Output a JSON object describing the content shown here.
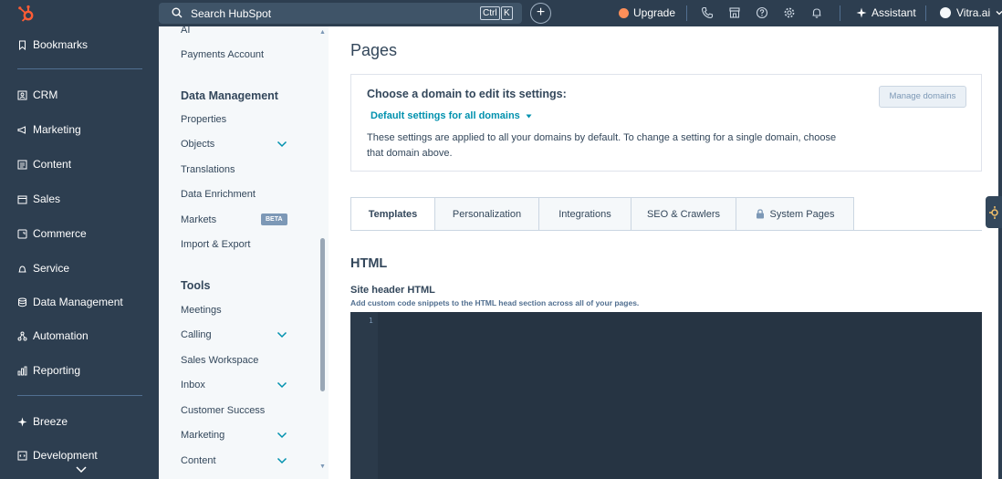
{
  "topbar": {
    "search_placeholder": "Search HubSpot",
    "kbd_ctrl": "Ctrl",
    "kbd_k": "K",
    "plus_label": "+",
    "upgrade_label": "Upgrade",
    "assistant_label": "Assistant",
    "account_name": "Vitra.ai"
  },
  "leftnav": {
    "bookmarks": "Bookmarks",
    "items": [
      "CRM",
      "Marketing",
      "Content",
      "Sales",
      "Commerce",
      "Service",
      "Data Management",
      "Automation",
      "Reporting"
    ],
    "breeze": "Breeze",
    "development": "Development"
  },
  "settingsnav": {
    "ai": "AI",
    "payments_account": "Payments Account",
    "data_management_heading": "Data Management",
    "data_management_items": [
      "Properties",
      "Objects",
      "Translations",
      "Data Enrichment",
      "Markets",
      "Import & Export"
    ],
    "beta_badge": "BETA",
    "tools_heading": "Tools",
    "tools_items": [
      "Meetings",
      "Calling",
      "Sales Workspace",
      "Inbox",
      "Customer Success",
      "Marketing",
      "Content"
    ]
  },
  "main": {
    "page_title": "Pages",
    "domain_heading": "Choose a domain to edit its settings:",
    "domain_dropdown": "Default settings for all domains",
    "domain_description": "These settings are applied to all your domains by default. To change a setting for a single domain, choose that domain above.",
    "manage_domains": "Manage domains",
    "tabs": [
      "Templates",
      "Personalization",
      "Integrations",
      "SEO & Crawlers",
      "System Pages"
    ],
    "section_title": "HTML",
    "field_label": "Site header HTML",
    "field_help": "Add custom code snippets to the HTML head section across all of your pages.",
    "line_number": "1"
  },
  "colors": {
    "nav_bg": "#2d3e50",
    "accent_orange": "#ff5c35",
    "link_teal": "#0091ae",
    "editor_bg": "#263443"
  }
}
